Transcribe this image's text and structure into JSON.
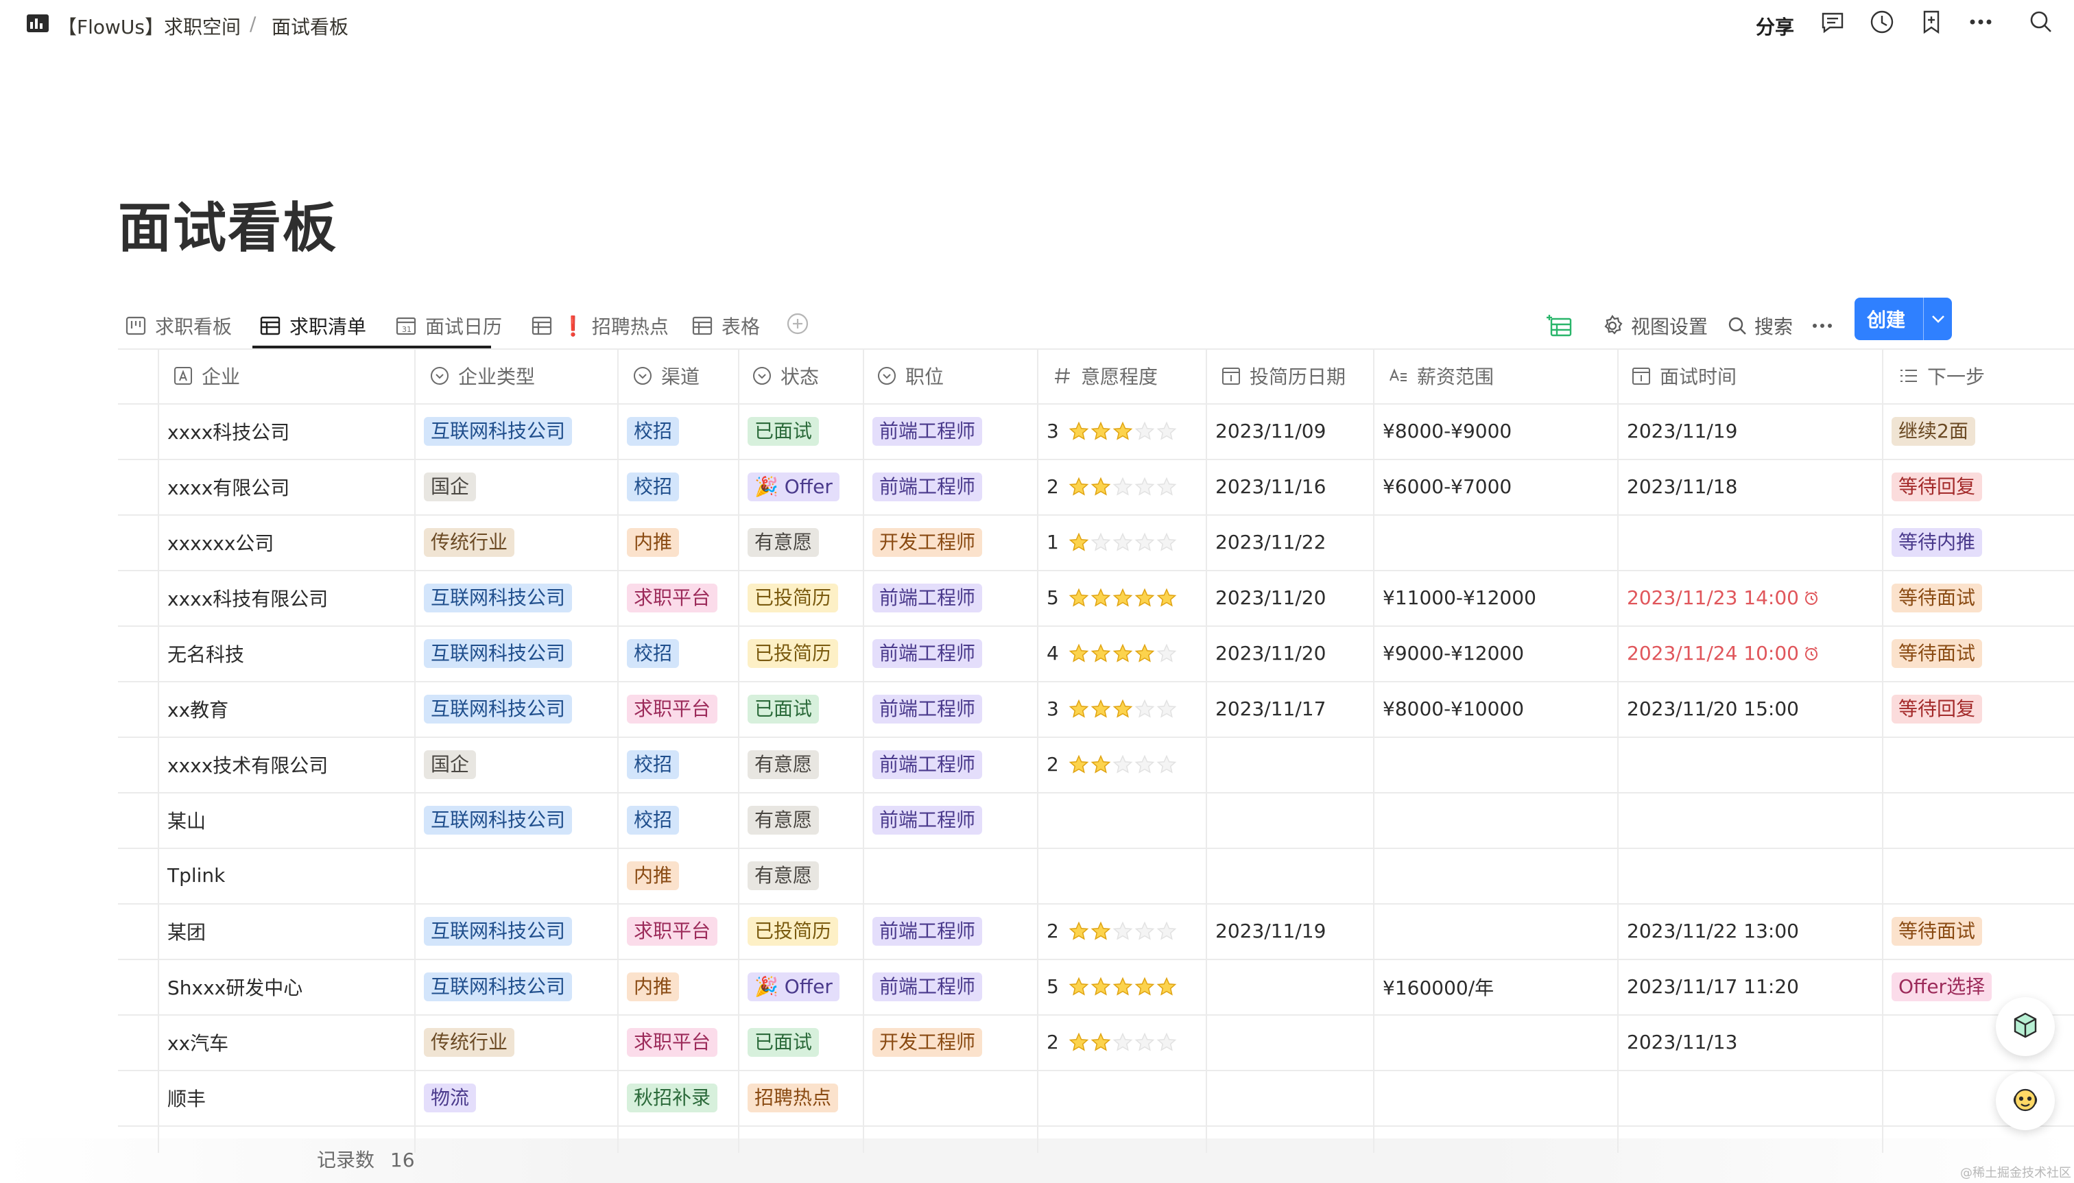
{
  "breadcrumb": {
    "workspace": "【FlowUs】求职空间",
    "separator": "/",
    "page": "面试看板"
  },
  "topbar": {
    "share": "分享",
    "icons": [
      "comment-icon",
      "clock-icon",
      "bookmark-icon",
      "more-icon",
      "search-icon"
    ]
  },
  "page_title": "面试看板",
  "tabs": [
    {
      "label": "求职看板",
      "icon": "board-icon",
      "active": false
    },
    {
      "label": "求职清单",
      "icon": "table-icon",
      "active": true
    },
    {
      "label": "面试日历",
      "icon": "calendar-icon",
      "active": false
    },
    {
      "label": "招聘热点",
      "prefix": "❗",
      "icon": "table-icon",
      "active": false
    },
    {
      "label": "表格",
      "icon": "table-icon",
      "active": false
    }
  ],
  "toolbar": {
    "view_settings": "视图设置",
    "search": "搜索",
    "create": "创建"
  },
  "columns": [
    "企业",
    "企业类型",
    "渠道",
    "状态",
    "职位",
    "意愿程度",
    "投简历日期",
    "薪资范围",
    "面试时间",
    "下一步"
  ],
  "colors": {
    "blue": {
      "bg": "#d3e5fb",
      "fg": "#1f4e8c"
    },
    "gray": {
      "bg": "#e8e6e1",
      "fg": "#4a4742"
    },
    "brown": {
      "bg": "#f0e4d3",
      "fg": "#6b4a24"
    },
    "orange": {
      "bg": "#fbe2cc",
      "fg": "#8a4b13"
    },
    "pink": {
      "bg": "#fbdcea",
      "fg": "#9c2b5a"
    },
    "green": {
      "bg": "#d7f0dc",
      "fg": "#2b6a3a"
    },
    "yellow": {
      "bg": "#fdf0c6",
      "fg": "#7a5a0f"
    },
    "purple": {
      "bg": "#e4defb",
      "fg": "#4a3a8c"
    },
    "red": {
      "bg": "#fbdcdc",
      "fg": "#a32a2a"
    },
    "accent": "#2f80ff",
    "overdue": "#e0565b"
  },
  "rows": [
    {
      "company": "xxxx科技公司",
      "type": {
        "t": "互联网科技公司",
        "c": "blue"
      },
      "channel": {
        "t": "校招",
        "c": "blue"
      },
      "status": {
        "t": "已面试",
        "c": "green"
      },
      "position": {
        "t": "前端工程师",
        "c": "purple"
      },
      "rating": 3,
      "apply": "2023/11/09",
      "salary": "¥8000-¥9000",
      "interview": "2023/11/19",
      "overdue": false,
      "next": {
        "t": "继续2面",
        "c": "brown"
      }
    },
    {
      "company": "xxxx有限公司",
      "type": {
        "t": "国企",
        "c": "gray"
      },
      "channel": {
        "t": "校招",
        "c": "blue"
      },
      "status": {
        "t": "🎉 Offer",
        "c": "purple"
      },
      "position": {
        "t": "前端工程师",
        "c": "purple"
      },
      "rating": 2,
      "apply": "2023/11/16",
      "salary": "¥6000-¥7000",
      "interview": "2023/11/18",
      "overdue": false,
      "next": {
        "t": "等待回复",
        "c": "red"
      }
    },
    {
      "company": "xxxxxx公司",
      "type": {
        "t": "传统行业",
        "c": "brown"
      },
      "channel": {
        "t": "内推",
        "c": "orange"
      },
      "status": {
        "t": "有意愿",
        "c": "gray"
      },
      "position": {
        "t": "开发工程师",
        "c": "orange"
      },
      "rating": 1,
      "apply": "2023/11/22",
      "salary": "",
      "interview": "",
      "overdue": false,
      "next": {
        "t": "等待内推",
        "c": "purple"
      }
    },
    {
      "company": "xxxx科技有限公司",
      "type": {
        "t": "互联网科技公司",
        "c": "blue"
      },
      "channel": {
        "t": "求职平台",
        "c": "pink"
      },
      "status": {
        "t": "已投简历",
        "c": "yellow"
      },
      "position": {
        "t": "前端工程师",
        "c": "purple"
      },
      "rating": 5,
      "apply": "2023/11/20",
      "salary": "¥11000-¥12000",
      "interview": "2023/11/23 14:00",
      "overdue": true,
      "next": {
        "t": "等待面试",
        "c": "orange"
      }
    },
    {
      "company": "无名科技",
      "type": {
        "t": "互联网科技公司",
        "c": "blue"
      },
      "channel": {
        "t": "校招",
        "c": "blue"
      },
      "status": {
        "t": "已投简历",
        "c": "yellow"
      },
      "position": {
        "t": "前端工程师",
        "c": "purple"
      },
      "rating": 4,
      "apply": "2023/11/20",
      "salary": "¥9000-¥12000",
      "interview": "2023/11/24 10:00",
      "overdue": true,
      "next": {
        "t": "等待面试",
        "c": "orange"
      }
    },
    {
      "company": "xx教育",
      "type": {
        "t": "互联网科技公司",
        "c": "blue"
      },
      "channel": {
        "t": "求职平台",
        "c": "pink"
      },
      "status": {
        "t": "已面试",
        "c": "green"
      },
      "position": {
        "t": "前端工程师",
        "c": "purple"
      },
      "rating": 3,
      "apply": "2023/11/17",
      "salary": "¥8000-¥10000",
      "interview": "2023/11/20 15:00",
      "overdue": false,
      "next": {
        "t": "等待回复",
        "c": "red"
      }
    },
    {
      "company": "xxxx技术有限公司",
      "type": {
        "t": "国企",
        "c": "gray"
      },
      "channel": {
        "t": "校招",
        "c": "blue"
      },
      "status": {
        "t": "有意愿",
        "c": "gray"
      },
      "position": {
        "t": "前端工程师",
        "c": "purple"
      },
      "rating": 2,
      "apply": "",
      "salary": "",
      "interview": "",
      "overdue": false,
      "next": null
    },
    {
      "company": "某山",
      "type": {
        "t": "互联网科技公司",
        "c": "blue"
      },
      "channel": {
        "t": "校招",
        "c": "blue"
      },
      "status": {
        "t": "有意愿",
        "c": "gray"
      },
      "position": {
        "t": "前端工程师",
        "c": "purple"
      },
      "rating": 0,
      "apply": "",
      "salary": "",
      "interview": "",
      "overdue": false,
      "next": null
    },
    {
      "company": "Tplink",
      "type": null,
      "channel": {
        "t": "内推",
        "c": "orange"
      },
      "status": {
        "t": "有意愿",
        "c": "gray"
      },
      "position": null,
      "rating": 0,
      "apply": "",
      "salary": "",
      "interview": "",
      "overdue": false,
      "next": null
    },
    {
      "company": "某团",
      "type": {
        "t": "互联网科技公司",
        "c": "blue"
      },
      "channel": {
        "t": "求职平台",
        "c": "pink"
      },
      "status": {
        "t": "已投简历",
        "c": "yellow"
      },
      "position": {
        "t": "前端工程师",
        "c": "purple"
      },
      "rating": 2,
      "apply": "2023/11/19",
      "salary": "",
      "interview": "2023/11/22 13:00",
      "overdue": false,
      "next": {
        "t": "等待面试",
        "c": "orange"
      }
    },
    {
      "company": "Shxxx研发中心",
      "type": {
        "t": "互联网科技公司",
        "c": "blue"
      },
      "channel": {
        "t": "内推",
        "c": "orange"
      },
      "status": {
        "t": "🎉 Offer",
        "c": "purple"
      },
      "position": {
        "t": "前端工程师",
        "c": "purple"
      },
      "rating": 5,
      "apply": "",
      "salary": "¥160000/年",
      "interview": "2023/11/17 11:20",
      "overdue": false,
      "next": {
        "t": "Offer选择",
        "c": "pink"
      }
    },
    {
      "company": "xx汽车",
      "type": {
        "t": "传统行业",
        "c": "brown"
      },
      "channel": {
        "t": "求职平台",
        "c": "pink"
      },
      "status": {
        "t": "已面试",
        "c": "green"
      },
      "position": {
        "t": "开发工程师",
        "c": "orange"
      },
      "rating": 2,
      "apply": "",
      "salary": "",
      "interview": "2023/11/13",
      "overdue": false,
      "next": null
    },
    {
      "company": "顺丰",
      "type": {
        "t": "物流",
        "c": "purple"
      },
      "channel": {
        "t": "秋招补录",
        "c": "green"
      },
      "status": {
        "t": "招聘热点",
        "c": "orange"
      },
      "position": null,
      "rating": 0,
      "apply": "",
      "salary": "",
      "interview": "",
      "overdue": false,
      "next": null
    }
  ],
  "footer": {
    "label": "记录数",
    "count": "16"
  },
  "watermark": "@稀土掘金技术社区"
}
